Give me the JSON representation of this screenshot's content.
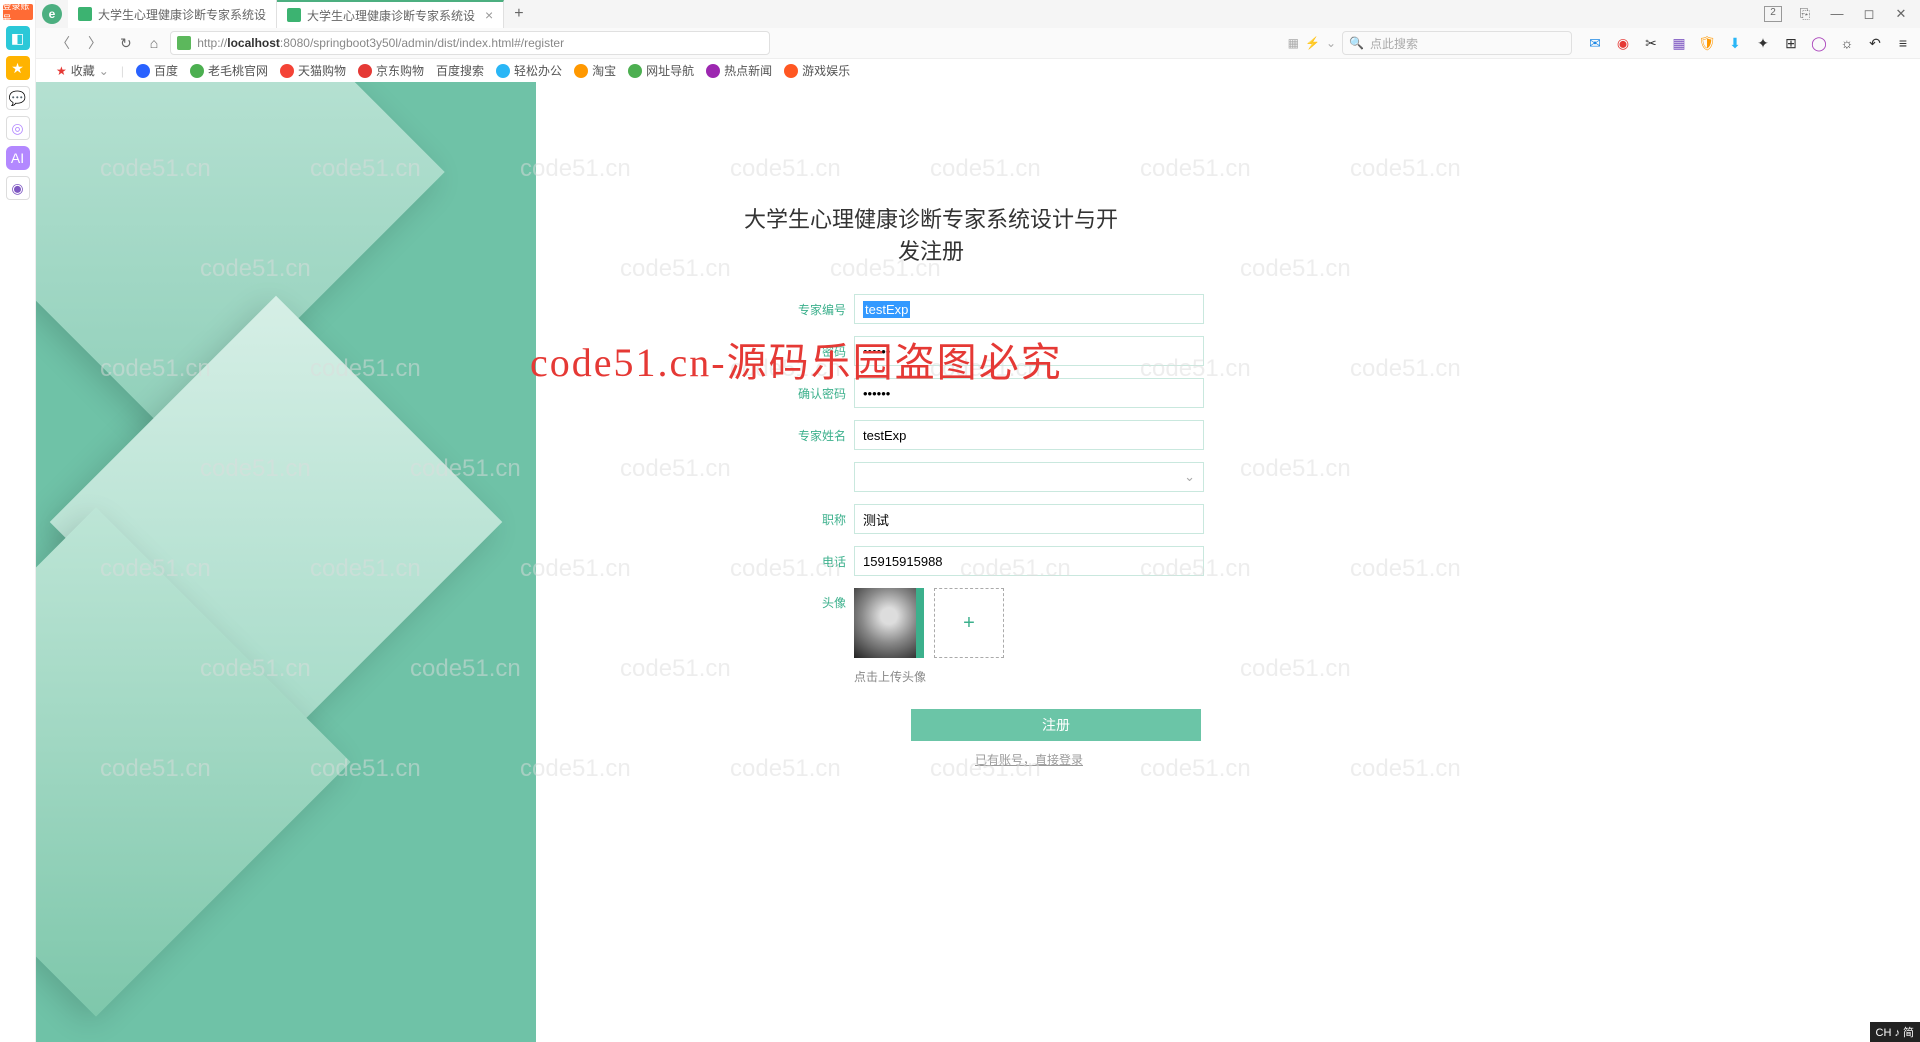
{
  "sidebar_badge": "登录账号",
  "tabs": {
    "inactive": "大学生心理健康诊断专家系统设",
    "active": "大学生心理健康诊断专家系统设",
    "badge_num": "2"
  },
  "url": "http://localhost:8080/springboot3y50l/admin/dist/index.html#/register",
  "url_host": "localhost",
  "search_placeholder": "点此搜索",
  "bookmarks": {
    "fav": "收藏",
    "baidu": "百度",
    "laomao": "老毛桃官网",
    "tmall": "天猫购物",
    "jd": "京东购物",
    "bdsearch": "百度搜索",
    "relax": "轻松办公",
    "taobao": "淘宝",
    "nav": "网址导航",
    "news": "热点新闻",
    "game": "游戏娱乐"
  },
  "form": {
    "title": "大学生心理健康诊断专家系统设计与开发注册",
    "labels": {
      "expert_no": "专家编号",
      "password": "密码",
      "confirm": "确认密码",
      "name": "专家姓名",
      "title": "职称",
      "phone": "电话",
      "avatar": "头像"
    },
    "values": {
      "expert_no": "testExp",
      "password": "••••••",
      "confirm": "••••••",
      "name": "testExp",
      "title": "测试",
      "phone": "15915915988"
    },
    "hint": "点击上传头像",
    "register_btn": "注册",
    "login_link": "已有账号，直接登录"
  },
  "watermark": "code51.cn",
  "wm_red": "code51.cn-源码乐园盗图必究",
  "ime": "CH ♪ 简"
}
